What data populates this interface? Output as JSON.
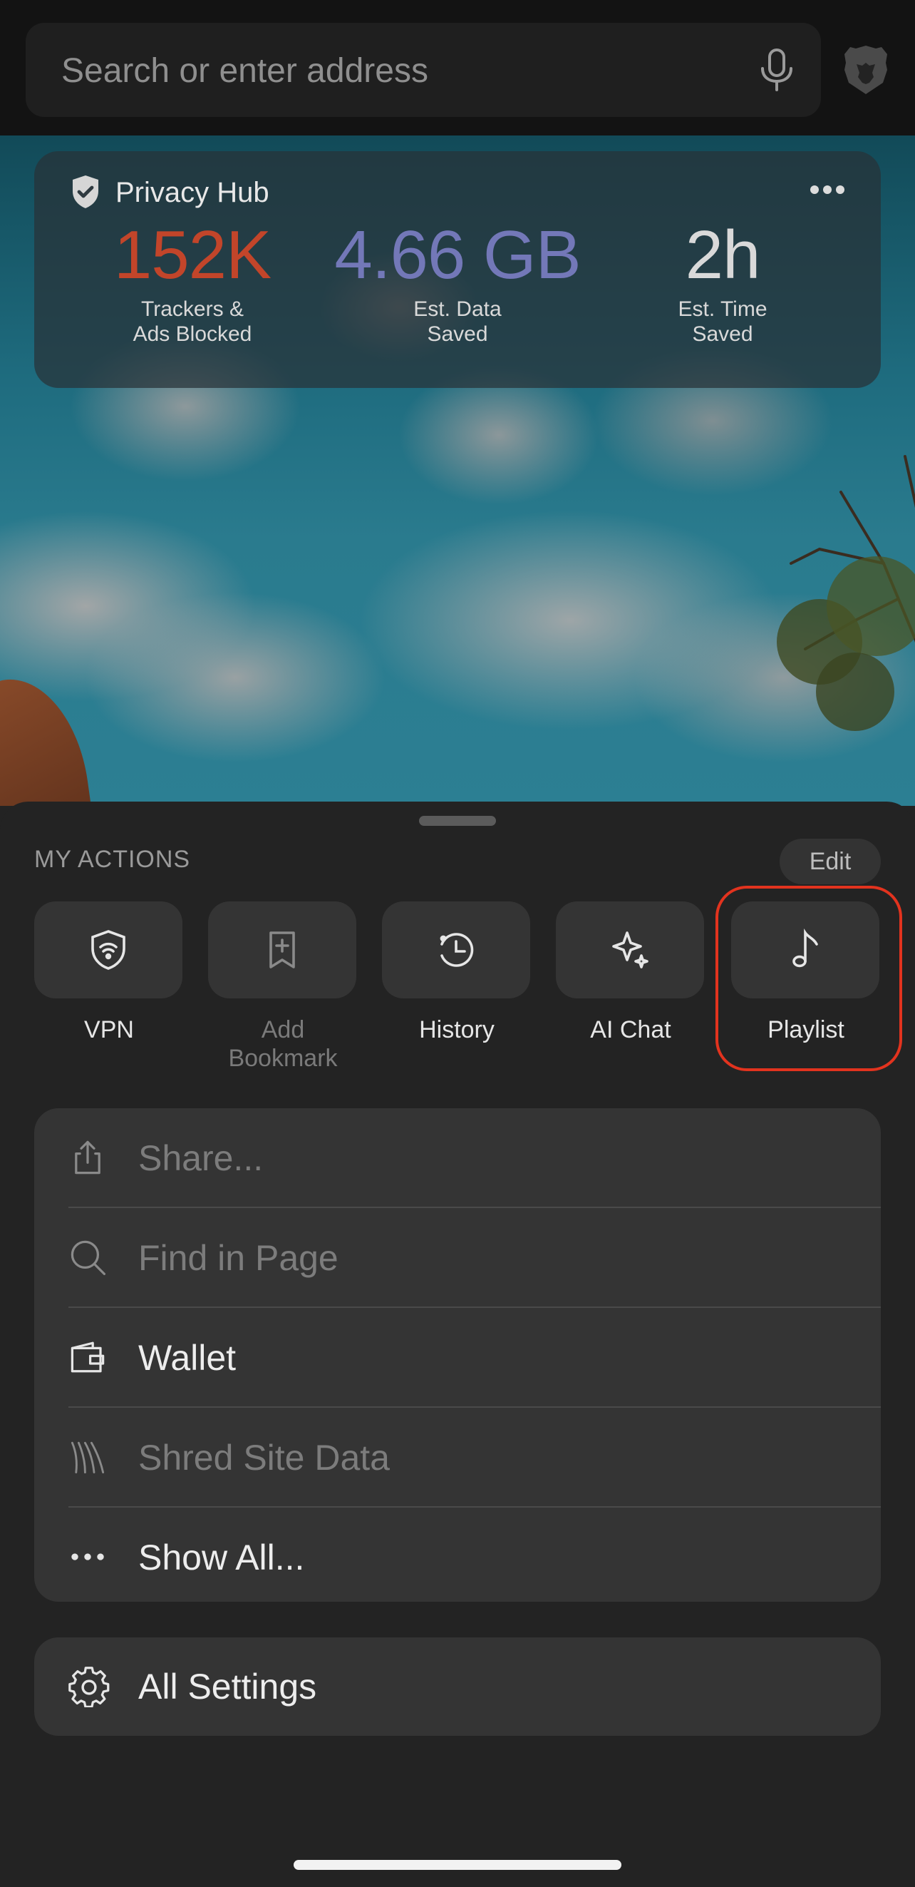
{
  "search": {
    "placeholder": "Search or enter address"
  },
  "privacy_hub": {
    "title": "Privacy Hub",
    "stats": [
      {
        "value": "152K",
        "label": "Trackers &\nAds Blocked",
        "color": "#c2452a"
      },
      {
        "value": "4.66 GB",
        "label": "Est. Data\nSaved",
        "color": "#7378b8"
      },
      {
        "value": "2h",
        "label": "Est. Time\nSaved",
        "color": "#d9d9d9"
      }
    ]
  },
  "actions": {
    "title": "MY ACTIONS",
    "edit_label": "Edit",
    "items": [
      {
        "label": "VPN",
        "icon": "vpn-shield-icon",
        "enabled": true
      },
      {
        "label": "Add\nBookmark",
        "icon": "add-bookmark-icon",
        "enabled": false
      },
      {
        "label": "History",
        "icon": "history-clock-icon",
        "enabled": true
      },
      {
        "label": "AI Chat",
        "icon": "sparkle-icon",
        "enabled": true
      },
      {
        "label": "Playlist",
        "icon": "music-note-icon",
        "enabled": true,
        "highlighted": true
      }
    ]
  },
  "menu": {
    "items": [
      {
        "label": "Share...",
        "icon": "share-icon",
        "enabled": false
      },
      {
        "label": "Find in Page",
        "icon": "magnifier-icon",
        "enabled": false
      },
      {
        "label": "Wallet",
        "icon": "wallet-icon",
        "enabled": true
      },
      {
        "label": "Shred Site Data",
        "icon": "shred-icon",
        "enabled": false
      },
      {
        "label": "Show All...",
        "icon": "ellipsis-icon",
        "enabled": true
      }
    ]
  },
  "settings": {
    "label": "All Settings",
    "icon": "gear-icon"
  },
  "colors": {
    "highlight": "#e2331e",
    "sheet": "#232323",
    "tile": "#343434"
  }
}
